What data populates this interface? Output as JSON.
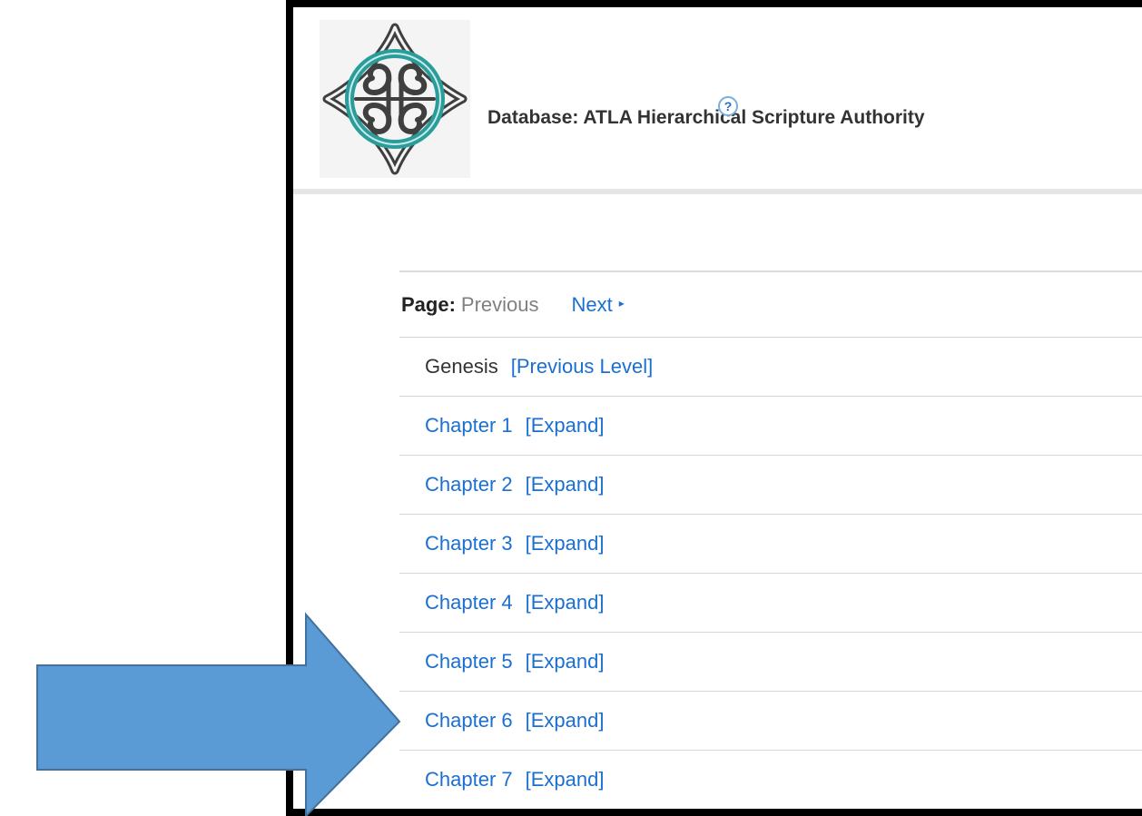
{
  "header": {
    "title": "Database: ATLA Hierarchical Scripture Authority",
    "help_glyph": "?",
    "logo_icon": "celtic-knot-logo"
  },
  "pager": {
    "label": "Page:",
    "previous": "Previous",
    "next": "Next",
    "next_arrow": "▸"
  },
  "parent_row": {
    "name": "Genesis",
    "action": "[Previous Level]"
  },
  "rows": [
    {
      "name": "Chapter 1",
      "action": "[Expand]"
    },
    {
      "name": "Chapter 2",
      "action": "[Expand]"
    },
    {
      "name": "Chapter 3",
      "action": "[Expand]"
    },
    {
      "name": "Chapter 4",
      "action": "[Expand]"
    },
    {
      "name": "Chapter 5",
      "action": "[Expand]"
    },
    {
      "name": "Chapter 6",
      "action": "[Expand]"
    },
    {
      "name": "Chapter 7",
      "action": "[Expand]"
    }
  ],
  "annotation": {
    "icon": "pointer-arrow-icon",
    "color": "#5b9bd5",
    "outline": "#41719c"
  },
  "colors": {
    "link": "#1a6fd1",
    "logo_teal": "#2a9d9a",
    "logo_dark": "#4a4a4a"
  }
}
